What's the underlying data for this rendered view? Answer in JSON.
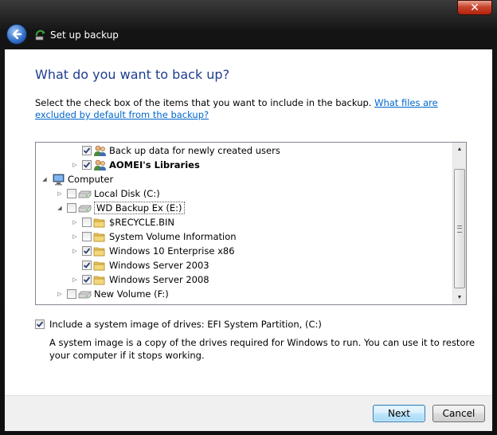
{
  "window": {
    "title": "Set up backup",
    "close_symbol": "✕",
    "icons": {
      "back": "back-arrow-icon",
      "app": "backup-app-icon",
      "close": "close-icon"
    }
  },
  "heading": "What do you want to back up?",
  "intro": {
    "text": "Select the check box of the items that you want to include in the backup. ",
    "link": "What files are excluded by default from the backup?"
  },
  "tree": {
    "items": [
      {
        "label": "Back up data for newly created users",
        "checked": true,
        "expander": "",
        "icon": "users-icon",
        "bold": false
      },
      {
        "label": "AOMEI's Libraries",
        "checked": true,
        "expander": "collapsed",
        "icon": "users-icon",
        "bold": true
      },
      {
        "label": "Computer",
        "checked": null,
        "expander": "expanded",
        "icon": "computer-icon",
        "bold": false
      },
      {
        "label": "Local Disk (C:)",
        "checked": false,
        "expander": "collapsed",
        "icon": "drive-icon",
        "bold": false
      },
      {
        "label": "WD Backup Ex  (E:)",
        "checked": false,
        "expander": "expanded",
        "icon": "drive-icon",
        "bold": false,
        "selected": true
      },
      {
        "label": "$RECYCLE.BIN",
        "checked": false,
        "expander": "collapsed",
        "icon": "folder-icon",
        "bold": false
      },
      {
        "label": "System Volume Information",
        "checked": false,
        "expander": "collapsed",
        "icon": "folder-icon",
        "bold": false
      },
      {
        "label": "Windows 10 Enterprise x86",
        "checked": true,
        "expander": "collapsed",
        "icon": "folder-icon",
        "bold": false
      },
      {
        "label": "Windows Server 2003",
        "checked": true,
        "expander": "",
        "icon": "folder-icon",
        "bold": false
      },
      {
        "label": "Windows Server 2008",
        "checked": true,
        "expander": "collapsed",
        "icon": "folder-icon",
        "bold": false
      },
      {
        "label": "New Volume (F:)",
        "checked": false,
        "expander": "collapsed",
        "icon": "drive-icon",
        "bold": false
      }
    ]
  },
  "system_image": {
    "checked": true,
    "label": "Include a system image of drives: EFI System Partition, (C:)",
    "description": "A system image is a copy of the drives required for Windows to run. You can use it to restore your computer if it stops working."
  },
  "buttons": {
    "next": "Next",
    "cancel": "Cancel"
  }
}
